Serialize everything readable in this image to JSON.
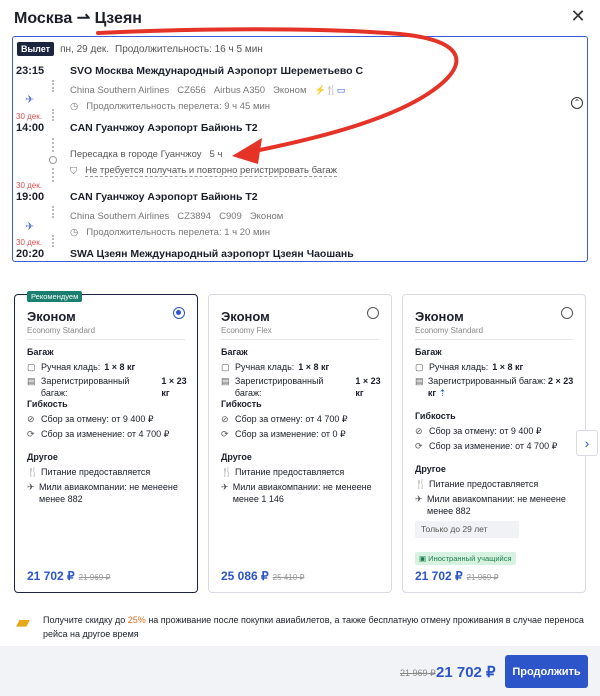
{
  "header": {
    "title": "Москва ⇀ Цзеян",
    "close_icon": "close-icon"
  },
  "flight": {
    "badge": "Вылет",
    "date": "пн, 29 дек.",
    "duration": "Продолжительность: 16 ч 5 мин",
    "seg1": {
      "dep_time": "23:15",
      "dep_airport": "SVO Москва Международный Аэропорт Шереметьево C",
      "airline": "China Southern Airlines",
      "flight_no": "CZ656",
      "aircraft": "Airbus A350",
      "cabin": "Эконом",
      "amenities": "⚡🍴▭",
      "flight_duration": "Продолжительность перелета: 9 ч 45 мин",
      "arr_date": "30 дек.",
      "arr_time": "14:00",
      "arr_airport": "CAN Гуанчжоу Аэропорт Байюнь T2"
    },
    "transfer": {
      "city": "Пересадка в городе Гуанчжоу",
      "time": "5 ч",
      "note": "Не требуется получать и повторно регистрировать багаж"
    },
    "seg2": {
      "dep_date": "30 дек.",
      "dep_time": "19:00",
      "dep_airport": "CAN Гуанчжоу Аэропорт Байюнь T2",
      "airline": "China Southern Airlines",
      "flight_no": "CZ3894",
      "codeshare": "C909",
      "cabin": "Эконом",
      "flight_duration": "Продолжительность перелета: 1 ч 20 мин",
      "arr_date": "30 дек.",
      "arr_time": "20:20",
      "arr_airport": "SWA Цзеян Международный аэропорт Цзеян Чаошань"
    }
  },
  "fares": [
    {
      "badge": "Рекомендуем",
      "title": "Эконом",
      "subtitle": "Economy Standard",
      "baggage_h": "Багаж",
      "hand": "Ручная кладь:",
      "hand_val": "1 × 8 кг",
      "checked": "Зарегистрированный багаж:",
      "checked_val": "1 × 23 кг",
      "flex_h": "Гибкость",
      "cancel": "Сбор за отмену: от 9 400 ₽",
      "change": "Сбор за изменение: от 4 700 ₽",
      "other_h": "Другое",
      "meal": "Питание предоставляется",
      "miles": "Мили авиакомпании: не менеене менее 882",
      "price": "21 702 ₽",
      "old_price": "21 969 ₽"
    },
    {
      "title": "Эконом",
      "subtitle": "Economy Flex",
      "baggage_h": "Багаж",
      "hand": "Ручная кладь:",
      "hand_val": "1 × 8 кг",
      "checked": "Зарегистрированный багаж:",
      "checked_val": "1 × 23 кг",
      "flex_h": "Гибкость",
      "cancel": "Сбор за отмену: от 4 700 ₽",
      "change": "Сбор за изменение: от 0 ₽",
      "other_h": "Другое",
      "meal": "Питание предоставляется",
      "miles": "Мили авиакомпании: не менеене менее 1 146",
      "price": "25 086 ₽",
      "old_price": "25 410 ₽"
    },
    {
      "title": "Эконом",
      "subtitle": "Economy Standard",
      "baggage_h": "Багаж",
      "hand": "Ручная кладь:",
      "hand_val": "1 × 8 кг",
      "checked": "Зарегистрированный багаж:",
      "checked_val": "2 × 23 кг",
      "flex_h": "Гибкость",
      "cancel": "Сбор за отмену: от 9 400 ₽",
      "change": "Сбор за изменение: от 4 700 ₽",
      "other_h": "Другое",
      "meal": "Питание предоставляется",
      "miles": "Мили авиакомпании: не менеене менее 882",
      "note": "Только до 29 лет",
      "student": "Иностранный учащийся",
      "price": "21 702 ₽",
      "old_price": "21 969 ₽"
    }
  ],
  "promo": {
    "before": "Получите скидку до ",
    "pct": "25%",
    "after": " на проживание после покупки авиабилетов, а также бесплатную отмену проживания в случае переноса рейса на другое время"
  },
  "footer": {
    "old_price": "21 969 ₽",
    "price": "21 702 ₽",
    "continue": "Продолжить"
  },
  "colors": {
    "accent": "#2b55c9",
    "arrow": "#e53327",
    "recommend": "#1a7f6e"
  }
}
